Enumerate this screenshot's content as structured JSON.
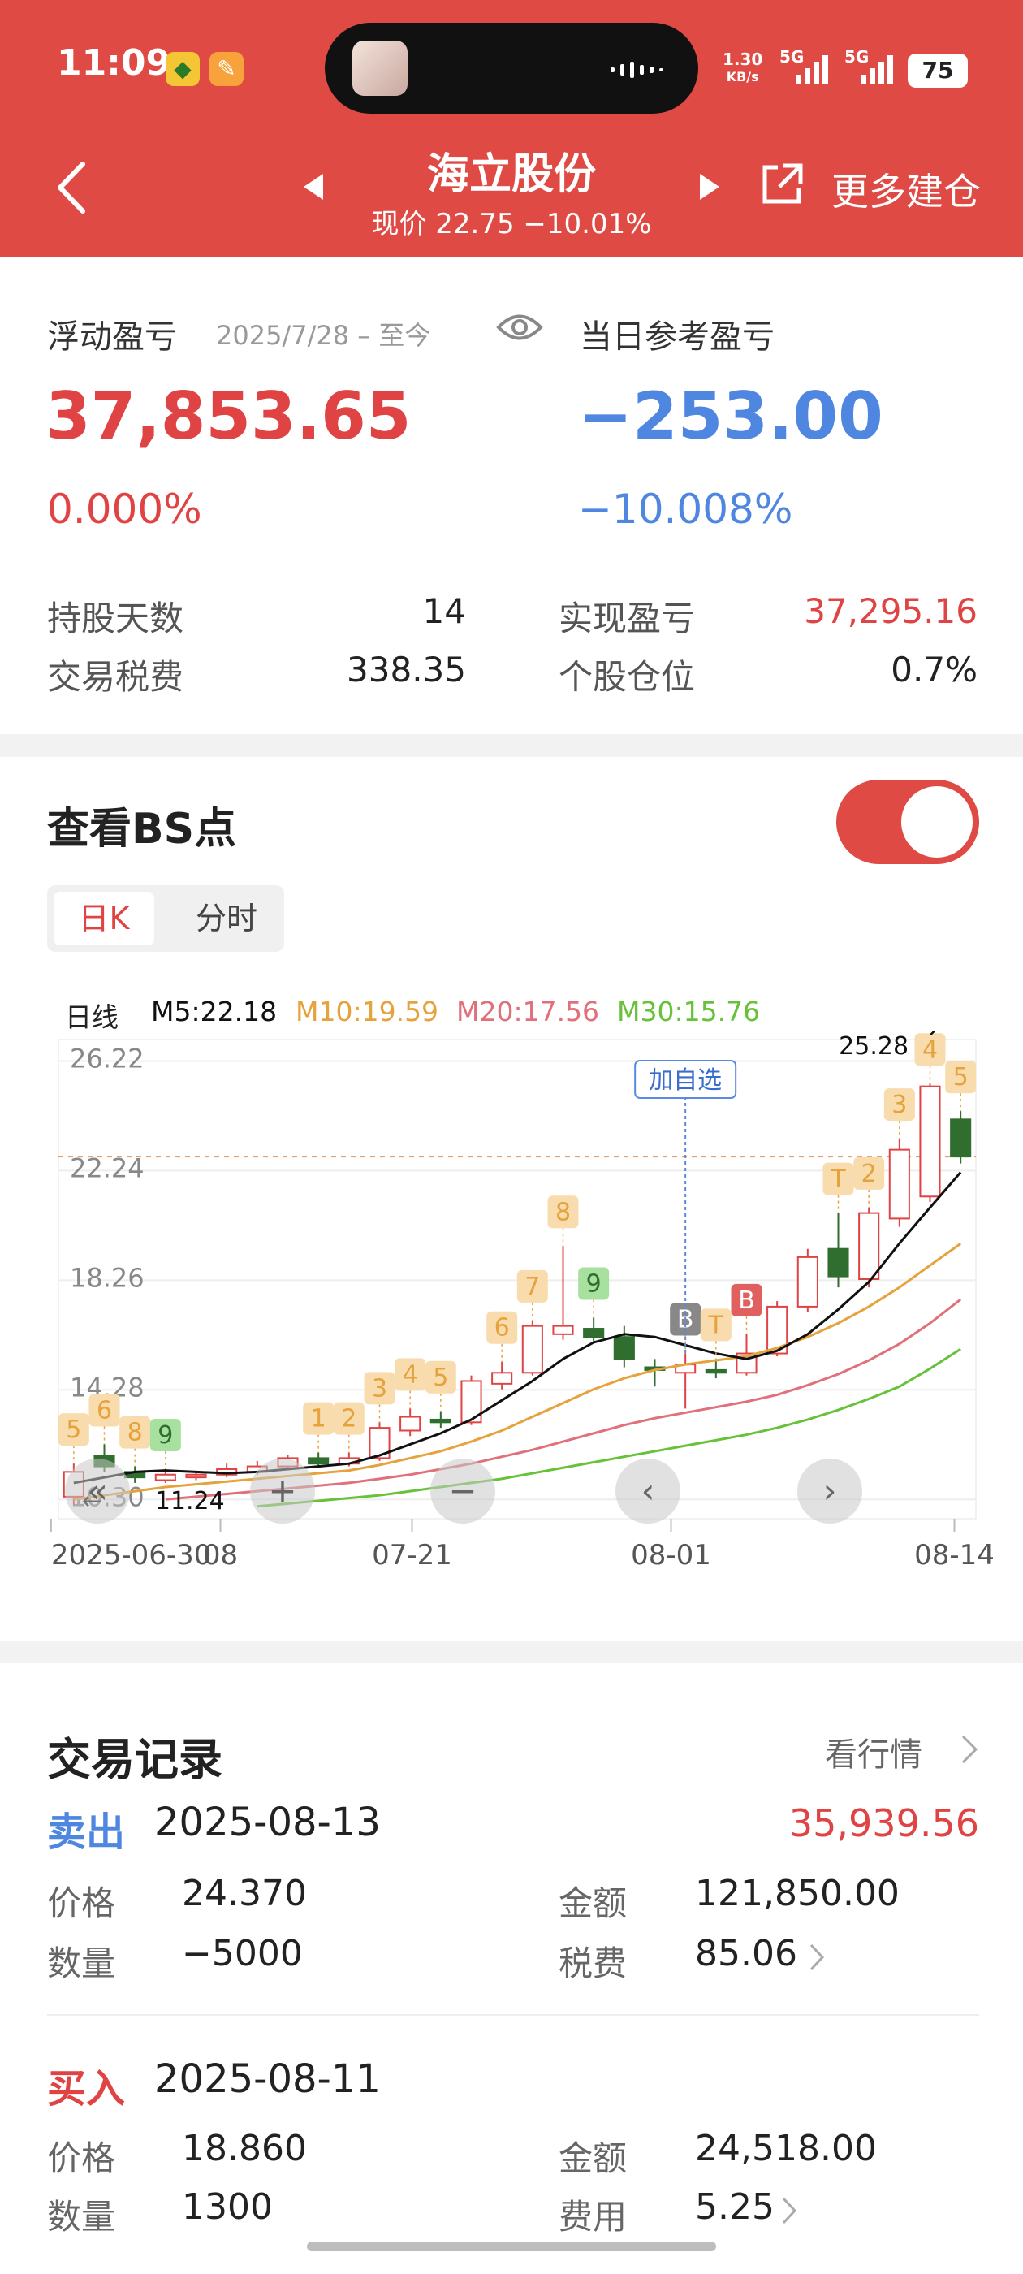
{
  "status_bar": {
    "time": "11:09",
    "net_speed": "1.30",
    "net_unit": "KB/s",
    "sig1": "5G",
    "sig2": "5G",
    "battery": "75"
  },
  "nav": {
    "title": "海立股份",
    "subtitle": "现价 22.75 −10.01%",
    "more_label": "更多建仓"
  },
  "pnl": {
    "float_label": "浮动盈亏",
    "period": "2025/7/28 – 至今",
    "float_value": "37,853.65",
    "float_pct": "0.000%",
    "day_label": "当日参考盈亏",
    "day_value": "−253.00",
    "day_pct": "−10.008%",
    "stats": [
      {
        "label": "持股天数",
        "value": "14"
      },
      {
        "label": "实现盈亏",
        "value": "37,295.16"
      },
      {
        "label": "交易税费",
        "value": "338.35"
      },
      {
        "label": "个股仓位",
        "value": "0.7%"
      }
    ]
  },
  "bs": {
    "title": "查看BS点",
    "tab_day": "日K",
    "tab_min": "分时",
    "legend": [
      "日线",
      "M5:22.18",
      "M10:19.59",
      "M20:17.56",
      "M30:15.76"
    ],
    "colors": {
      "m5": "#111111",
      "m10": "#e6a23c",
      "m20": "#e0707a",
      "m30": "#67c23a",
      "up": "#e04343",
      "down": "#2f6e2f"
    }
  },
  "chart_data": {
    "type": "candlestick",
    "y_ticks": [
      "26.22",
      "22.24",
      "18.26",
      "14.28",
      "10.30"
    ],
    "x_ticks": [
      "2025-06-30",
      "08",
      "07-21",
      "08-01",
      "08-14"
    ],
    "max_label": "25.28",
    "min_label": "11.24",
    "current_price": 22.75,
    "annotation": "加自选",
    "candles": [
      {
        "o": 10.4,
        "c": 11.3,
        "h": 11.6,
        "l": 10.1
      },
      {
        "o": 11.9,
        "c": 11.5,
        "h": 12.3,
        "l": 11.3
      },
      {
        "o": 11.3,
        "c": 11.1,
        "h": 11.5,
        "l": 10.9
      },
      {
        "o": 11.0,
        "c": 11.2,
        "h": 11.4,
        "l": 10.9
      },
      {
        "o": 11.1,
        "c": 11.2,
        "h": 11.3,
        "l": 11.0
      },
      {
        "o": 11.2,
        "c": 11.4,
        "h": 11.6,
        "l": 11.1
      },
      {
        "o": 11.3,
        "c": 11.5,
        "h": 11.7,
        "l": 11.2
      },
      {
        "o": 11.5,
        "c": 11.8,
        "h": 11.9,
        "l": 11.4
      },
      {
        "o": 11.8,
        "c": 11.6,
        "h": 12.0,
        "l": 11.5
      },
      {
        "o": 11.6,
        "c": 11.8,
        "h": 12.0,
        "l": 11.5
      },
      {
        "o": 11.8,
        "c": 12.9,
        "h": 13.1,
        "l": 11.7
      },
      {
        "o": 12.8,
        "c": 13.3,
        "h": 13.6,
        "l": 12.6
      },
      {
        "o": 13.2,
        "c": 13.1,
        "h": 13.5,
        "l": 12.9
      },
      {
        "o": 13.1,
        "c": 14.6,
        "h": 14.8,
        "l": 13.0
      },
      {
        "o": 14.5,
        "c": 14.9,
        "h": 15.3,
        "l": 14.3
      },
      {
        "o": 14.9,
        "c": 16.6,
        "h": 16.8,
        "l": 14.8
      },
      {
        "o": 16.3,
        "c": 16.6,
        "h": 19.5,
        "l": 16.1
      },
      {
        "o": 16.5,
        "c": 16.2,
        "h": 16.9,
        "l": 16.0
      },
      {
        "o": 16.2,
        "c": 15.4,
        "h": 16.6,
        "l": 15.1
      },
      {
        "o": 15.1,
        "c": 15.0,
        "h": 15.4,
        "l": 14.4
      },
      {
        "o": 14.9,
        "c": 15.2,
        "h": 15.6,
        "l": 13.6
      },
      {
        "o": 15.0,
        "c": 14.9,
        "h": 15.4,
        "l": 14.7
      },
      {
        "o": 14.9,
        "c": 15.6,
        "h": 16.3,
        "l": 14.8
      },
      {
        "o": 15.6,
        "c": 17.3,
        "h": 17.5,
        "l": 15.5
      },
      {
        "o": 17.3,
        "c": 19.1,
        "h": 19.4,
        "l": 17.1
      },
      {
        "o": 19.4,
        "c": 18.4,
        "h": 20.7,
        "l": 18.0
      },
      {
        "o": 18.3,
        "c": 20.7,
        "h": 20.9,
        "l": 18.0
      },
      {
        "o": 20.5,
        "c": 23.0,
        "h": 23.4,
        "l": 20.2
      },
      {
        "o": 21.3,
        "c": 25.3,
        "h": 25.4,
        "l": 21.1
      },
      {
        "o": 24.1,
        "c": 22.75,
        "h": 24.4,
        "l": 22.5
      }
    ],
    "ma": {
      "m5": [
        10.9,
        11.1,
        11.3,
        11.35,
        11.3,
        11.25,
        11.3,
        11.4,
        11.5,
        11.6,
        11.9,
        12.3,
        12.7,
        13.2,
        13.9,
        14.6,
        15.4,
        16.0,
        16.3,
        16.2,
        15.9,
        15.6,
        15.4,
        15.7,
        16.3,
        17.2,
        18.2,
        19.6,
        20.9,
        22.18
      ],
      "m10": [
        10.3,
        10.45,
        10.6,
        10.75,
        10.85,
        10.95,
        11.05,
        11.15,
        11.25,
        11.35,
        11.55,
        11.8,
        12.05,
        12.4,
        12.8,
        13.3,
        13.8,
        14.3,
        14.7,
        15.0,
        15.2,
        15.35,
        15.5,
        15.8,
        16.2,
        16.7,
        17.3,
        18.0,
        18.8,
        19.59
      ],
      "m20": [
        null,
        null,
        null,
        10.3,
        10.4,
        10.5,
        10.6,
        10.7,
        10.8,
        10.9,
        11.05,
        11.2,
        11.4,
        11.6,
        11.85,
        12.1,
        12.4,
        12.7,
        13.0,
        13.25,
        13.45,
        13.65,
        13.85,
        14.1,
        14.45,
        14.85,
        15.35,
        15.95,
        16.7,
        17.56
      ],
      "m30": [
        null,
        null,
        null,
        null,
        null,
        null,
        10.05,
        10.15,
        10.25,
        10.35,
        10.45,
        10.6,
        10.75,
        10.9,
        11.05,
        11.25,
        11.45,
        11.65,
        11.85,
        12.05,
        12.25,
        12.45,
        12.65,
        12.9,
        13.2,
        13.55,
        13.95,
        14.4,
        15.05,
        15.76
      ]
    },
    "markers": [
      {
        "i": 0,
        "label": "5",
        "kind": "up"
      },
      {
        "i": 1,
        "label": "6",
        "kind": "up"
      },
      {
        "i": 2,
        "label": "8",
        "kind": "up"
      },
      {
        "i": 3,
        "label": "9",
        "kind": "green"
      },
      {
        "i": 8,
        "label": "1",
        "kind": "up"
      },
      {
        "i": 9,
        "label": "2",
        "kind": "up"
      },
      {
        "i": 10,
        "label": "3",
        "kind": "up"
      },
      {
        "i": 11,
        "label": "4",
        "kind": "up"
      },
      {
        "i": 12,
        "label": "5",
        "kind": "up"
      },
      {
        "i": 14,
        "label": "6",
        "kind": "up"
      },
      {
        "i": 15,
        "label": "7",
        "kind": "up"
      },
      {
        "i": 16,
        "label": "8",
        "kind": "up"
      },
      {
        "i": 17,
        "label": "9",
        "kind": "green"
      },
      {
        "i": 20,
        "label": "B",
        "kind": "buy"
      },
      {
        "i": 21,
        "label": "T",
        "kind": "up"
      },
      {
        "i": 22,
        "label": "B",
        "kind": "sell"
      },
      {
        "i": 25,
        "label": "T",
        "kind": "up"
      },
      {
        "i": 26,
        "label": "2",
        "kind": "up"
      },
      {
        "i": 27,
        "label": "3",
        "kind": "up"
      },
      {
        "i": 28,
        "label": "4",
        "kind": "up"
      },
      {
        "i": 29,
        "label": "5",
        "kind": "up"
      }
    ]
  },
  "chart_controls": [
    "«",
    "+",
    "−",
    "‹",
    "›"
  ],
  "trades": {
    "title": "交易记录",
    "link": "看行情",
    "records": [
      {
        "side": "卖出",
        "date": "2025-08-13",
        "amount_total": "35,939.56",
        "price_label": "价格",
        "price": "24.370",
        "amount_label": "金额",
        "amount": "121,850.00",
        "qty_label": "数量",
        "qty": "−5000",
        "fee_label": "税费",
        "fee": "85.06"
      },
      {
        "side": "买入",
        "date": "2025-08-11",
        "price_label": "价格",
        "price": "18.860",
        "amount_label": "金额",
        "amount": "24,518.00",
        "qty_label": "数量",
        "qty": "1300",
        "fee_label": "费用",
        "fee": "5.25"
      }
    ]
  }
}
